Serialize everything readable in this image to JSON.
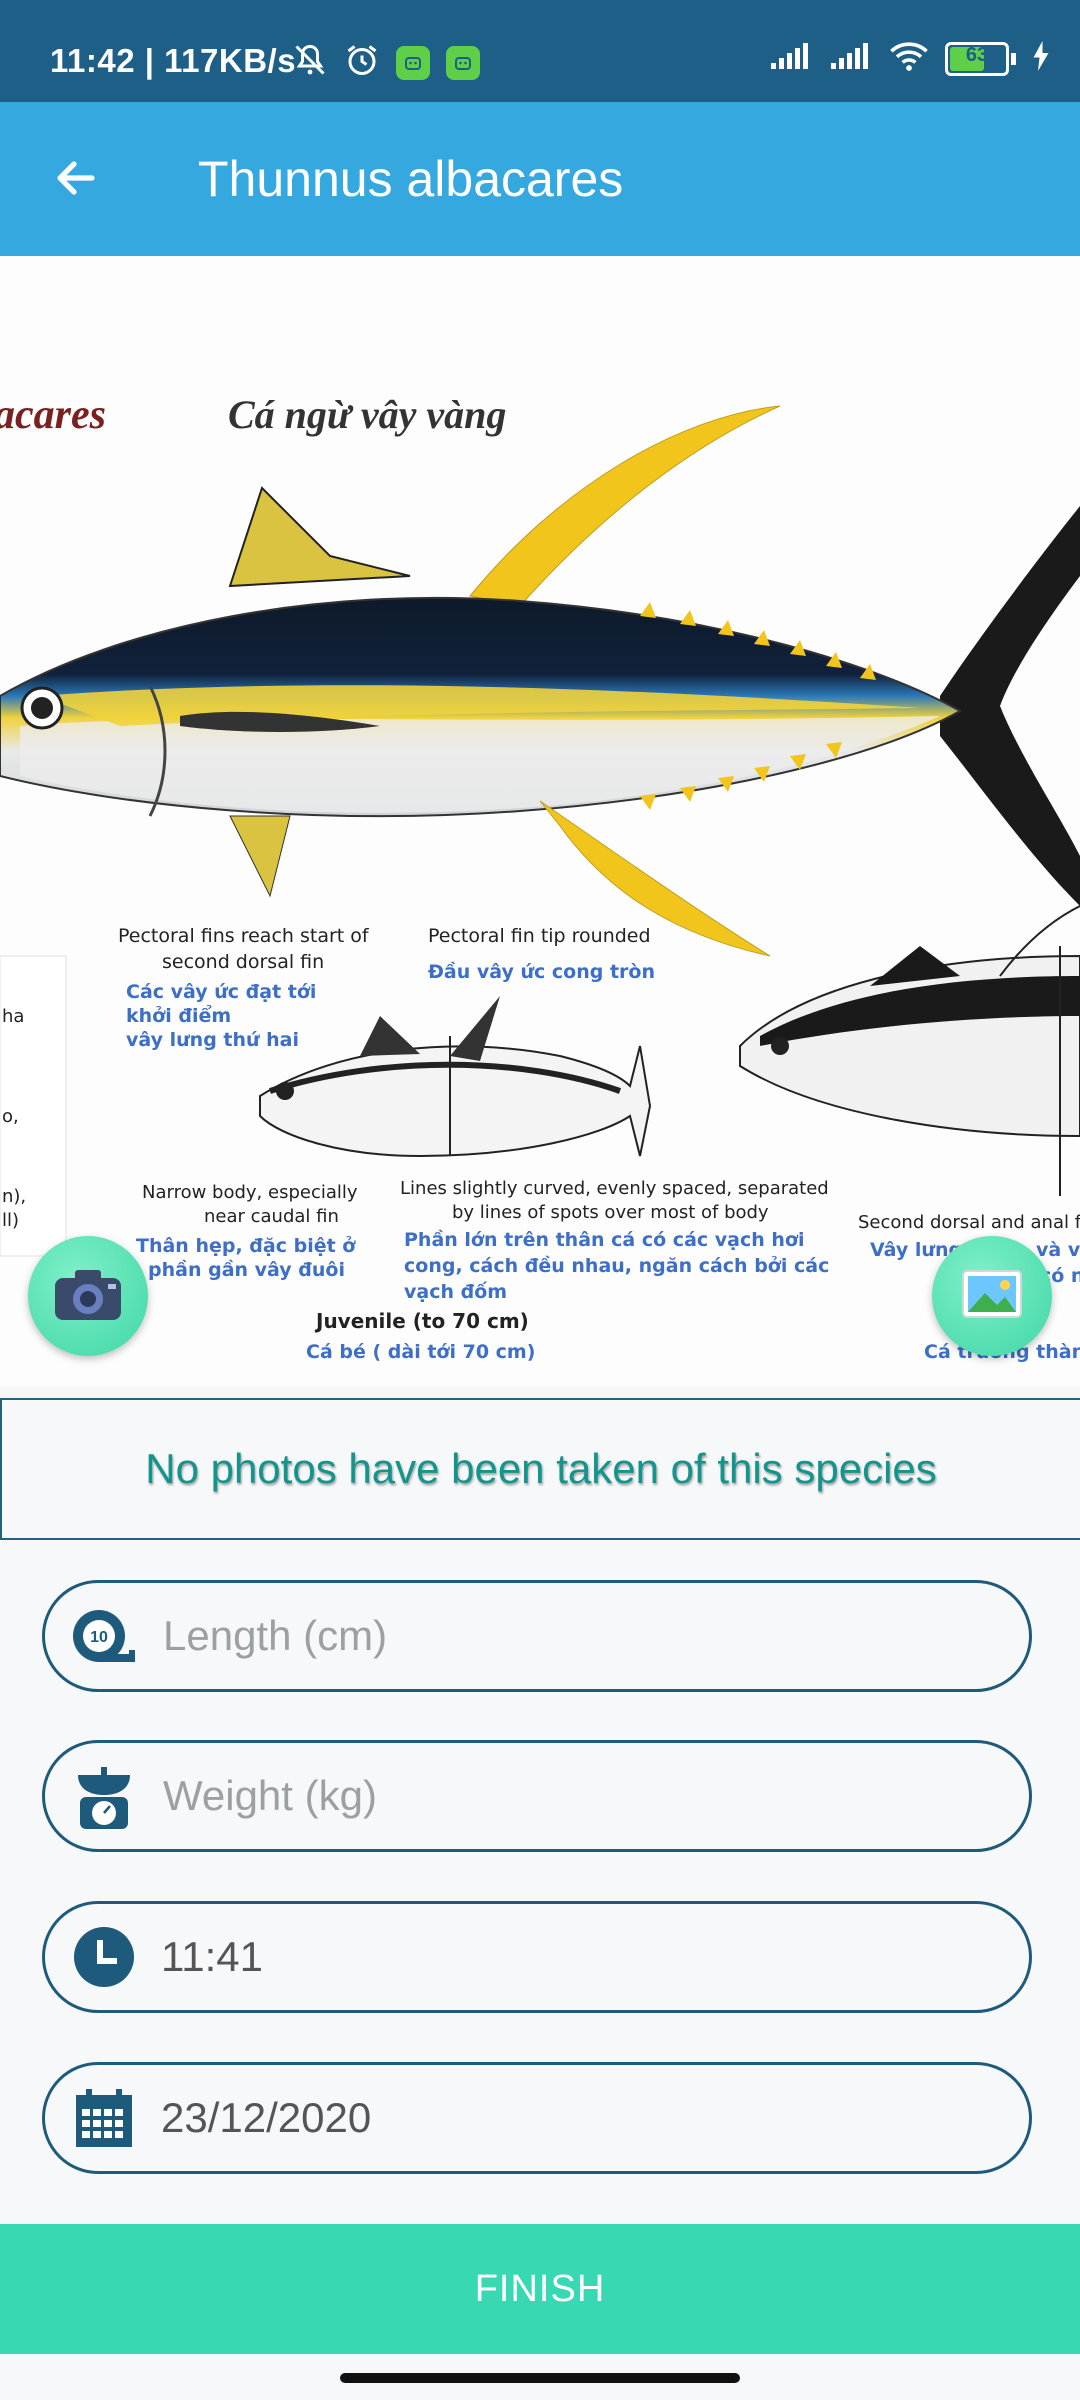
{
  "status_bar": {
    "time": "11:42 | 117KB/s",
    "battery_level": "63",
    "icons": [
      "mute-bell-icon",
      "alarm-icon",
      "app-notification-icon",
      "app-notification-icon",
      "signal-icon",
      "signal-icon",
      "wifi-icon",
      "battery-icon",
      "charging-icon"
    ]
  },
  "app_bar": {
    "title": "Thunnus albacares",
    "back_icon": "arrow-left-icon"
  },
  "species_image": {
    "heading_latin_partial": "acares",
    "heading_vietnamese": "Cá ngừ vây vàng",
    "notes": [
      {
        "en": "Pectoral fins reach start of",
        "en2": "second dorsal fin",
        "vi": "Các vây ức đạt tới",
        "vi2": "khởi điểm",
        "vi3": "vây lưng thứ hai"
      },
      {
        "en": "Pectoral fin tip rounded",
        "vi": "Đầu vây ức cong tròn"
      },
      {
        "en": "Narrow body, especially",
        "en2": "near caudal fin",
        "vi": "Thân hẹp, đặc biệt ở",
        "vi2": "phần gần vây đuôi"
      },
      {
        "en": "Lines slightly curved, evenly spaced, separated",
        "en2": "by lines of spots over most of body",
        "vi": "Phần lớn trên thân cá có các vạch hơi",
        "vi2": "cong, cách đều nhau, ngăn cách bởi các",
        "vi3": "vạch đốm"
      },
      {
        "en": "Juvenile (to 70 cm)",
        "vi": "Cá bé ( dài tới 70 cm)"
      },
      {
        "en": "Second dorsal and anal fi",
        "vi": "Vây lưng",
        "vi2": "và v",
        "vi3": "có n"
      },
      {
        "vi": "Cá trưởng thàn"
      }
    ],
    "left_edge_fragments": [
      "ha",
      "o,",
      "n),",
      "ll)"
    ]
  },
  "actions": {
    "camera_icon": "camera-icon",
    "gallery_icon": "gallery-icon"
  },
  "message": "No photos have been taken of this species",
  "fields": {
    "length": {
      "placeholder": "Length (cm)",
      "value": "",
      "icon": "tape-measure-icon",
      "icon_label": "10"
    },
    "weight": {
      "placeholder": "Weight (kg)",
      "value": "",
      "icon": "scale-icon"
    },
    "time": {
      "value": "11:41",
      "icon": "clock-icon"
    },
    "date": {
      "value": "23/12/2020",
      "icon": "calendar-icon"
    }
  },
  "finish_label": "FINISH",
  "colors": {
    "status_bar": "#1d5f86",
    "app_bar": "#35a8e0",
    "accent_teal": "#13958d",
    "finish_button": "#38d9b2",
    "field_border": "#1e5a7c"
  }
}
